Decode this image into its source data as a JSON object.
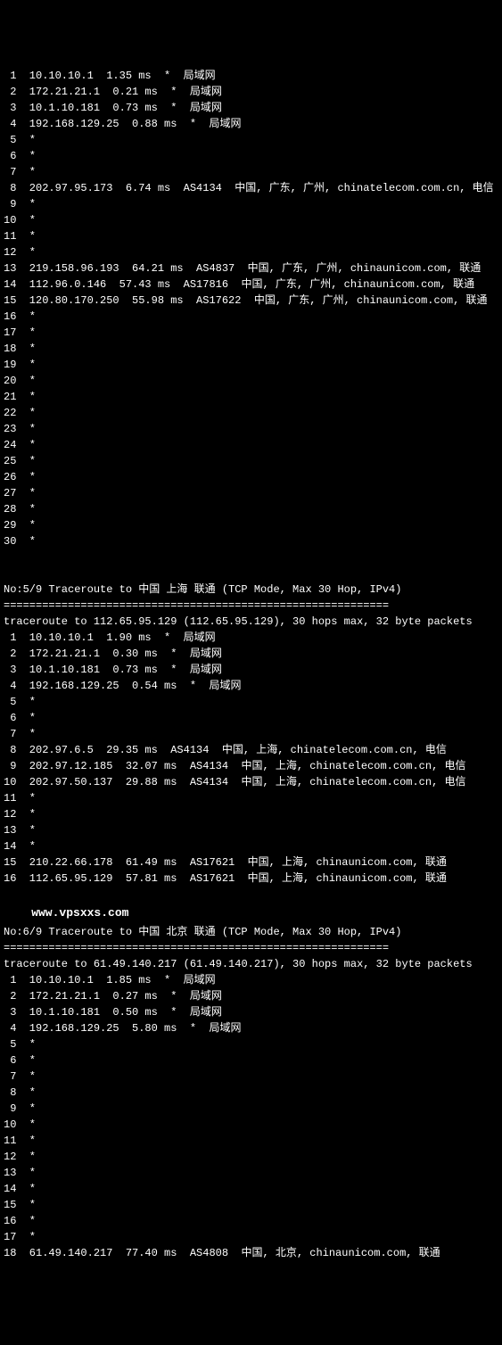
{
  "section1": {
    "hops": [
      {
        "n": " 1",
        "ip": "10.10.10.1",
        "lat": "1.35 ms",
        "star": "*",
        "info": "局域网"
      },
      {
        "n": " 2",
        "ip": "172.21.21.1",
        "lat": "0.21 ms",
        "star": "*",
        "info": "局域网"
      },
      {
        "n": " 3",
        "ip": "10.1.10.181",
        "lat": "0.73 ms",
        "star": "*",
        "info": "局域网"
      },
      {
        "n": " 4",
        "ip": "192.168.129.25",
        "lat": "0.88 ms",
        "star": "*",
        "info": "局域网"
      },
      {
        "n": " 5",
        "ip": "*",
        "lat": "",
        "star": "",
        "info": ""
      },
      {
        "n": " 6",
        "ip": "*",
        "lat": "",
        "star": "",
        "info": ""
      },
      {
        "n": " 7",
        "ip": "*",
        "lat": "",
        "star": "",
        "info": ""
      },
      {
        "n": " 8",
        "ip": "202.97.95.173",
        "lat": "6.74 ms",
        "star": "",
        "info": "AS4134  中国, 广东, 广州, chinatelecom.com.cn, 电信"
      },
      {
        "n": " 9",
        "ip": "*",
        "lat": "",
        "star": "",
        "info": ""
      },
      {
        "n": "10",
        "ip": "*",
        "lat": "",
        "star": "",
        "info": ""
      },
      {
        "n": "11",
        "ip": "*",
        "lat": "",
        "star": "",
        "info": ""
      },
      {
        "n": "12",
        "ip": "*",
        "lat": "",
        "star": "",
        "info": ""
      },
      {
        "n": "13",
        "ip": "219.158.96.193",
        "lat": "64.21 ms",
        "star": "",
        "info": "AS4837  中国, 广东, 广州, chinaunicom.com, 联通"
      },
      {
        "n": "14",
        "ip": "112.96.0.146",
        "lat": "57.43 ms",
        "star": "",
        "info": "AS17816  中国, 广东, 广州, chinaunicom.com, 联通"
      },
      {
        "n": "15",
        "ip": "120.80.170.250",
        "lat": "55.98 ms",
        "star": "",
        "info": "AS17622  中国, 广东, 广州, chinaunicom.com, 联通"
      },
      {
        "n": "16",
        "ip": "*",
        "lat": "",
        "star": "",
        "info": ""
      },
      {
        "n": "17",
        "ip": "*",
        "lat": "",
        "star": "",
        "info": ""
      },
      {
        "n": "18",
        "ip": "*",
        "lat": "",
        "star": "",
        "info": ""
      },
      {
        "n": "19",
        "ip": "*",
        "lat": "",
        "star": "",
        "info": ""
      },
      {
        "n": "20",
        "ip": "*",
        "lat": "",
        "star": "",
        "info": ""
      },
      {
        "n": "21",
        "ip": "*",
        "lat": "",
        "star": "",
        "info": ""
      },
      {
        "n": "22",
        "ip": "*",
        "lat": "",
        "star": "",
        "info": ""
      },
      {
        "n": "23",
        "ip": "*",
        "lat": "",
        "star": "",
        "info": ""
      },
      {
        "n": "24",
        "ip": "*",
        "lat": "",
        "star": "",
        "info": ""
      },
      {
        "n": "25",
        "ip": "*",
        "lat": "",
        "star": "",
        "info": ""
      },
      {
        "n": "26",
        "ip": "*",
        "lat": "",
        "star": "",
        "info": ""
      },
      {
        "n": "27",
        "ip": "*",
        "lat": "",
        "star": "",
        "info": ""
      },
      {
        "n": "28",
        "ip": "*",
        "lat": "",
        "star": "",
        "info": ""
      },
      {
        "n": "29",
        "ip": "*",
        "lat": "",
        "star": "",
        "info": ""
      },
      {
        "n": "30",
        "ip": "*",
        "lat": "",
        "star": "",
        "info": ""
      }
    ]
  },
  "section2": {
    "title": "No:5/9 Traceroute to 中国 上海 联通 (TCP Mode, Max 30 Hop, IPv4)",
    "divider": "============================================================",
    "header": "traceroute to 112.65.95.129 (112.65.95.129), 30 hops max, 32 byte packets",
    "hops": [
      {
        "n": " 1",
        "ip": "10.10.10.1",
        "lat": "1.90 ms",
        "star": "*",
        "info": "局域网"
      },
      {
        "n": " 2",
        "ip": "172.21.21.1",
        "lat": "0.30 ms",
        "star": "*",
        "info": "局域网"
      },
      {
        "n": " 3",
        "ip": "10.1.10.181",
        "lat": "0.73 ms",
        "star": "*",
        "info": "局域网"
      },
      {
        "n": " 4",
        "ip": "192.168.129.25",
        "lat": "0.54 ms",
        "star": "*",
        "info": "局域网"
      },
      {
        "n": " 5",
        "ip": "*",
        "lat": "",
        "star": "",
        "info": ""
      },
      {
        "n": " 6",
        "ip": "*",
        "lat": "",
        "star": "",
        "info": ""
      },
      {
        "n": " 7",
        "ip": "*",
        "lat": "",
        "star": "",
        "info": ""
      },
      {
        "n": " 8",
        "ip": "202.97.6.5",
        "lat": "29.35 ms",
        "star": "",
        "info": "AS4134  中国, 上海, chinatelecom.com.cn, 电信"
      },
      {
        "n": " 9",
        "ip": "202.97.12.185",
        "lat": "32.07 ms",
        "star": "",
        "info": "AS4134  中国, 上海, chinatelecom.com.cn, 电信"
      },
      {
        "n": "10",
        "ip": "202.97.50.137",
        "lat": "29.88 ms",
        "star": "",
        "info": "AS4134  中国, 上海, chinatelecom.com.cn, 电信"
      },
      {
        "n": "11",
        "ip": "*",
        "lat": "",
        "star": "",
        "info": ""
      },
      {
        "n": "12",
        "ip": "*",
        "lat": "",
        "star": "",
        "info": ""
      },
      {
        "n": "13",
        "ip": "*",
        "lat": "",
        "star": "",
        "info": ""
      },
      {
        "n": "14",
        "ip": "*",
        "lat": "",
        "star": "",
        "info": ""
      },
      {
        "n": "15",
        "ip": "210.22.66.178",
        "lat": "61.49 ms",
        "star": "",
        "info": "AS17621  中国, 上海, chinaunicom.com, 联通"
      },
      {
        "n": "16",
        "ip": "112.65.95.129",
        "lat": "57.81 ms",
        "star": "",
        "info": "AS17621  中国, 上海, chinaunicom.com, 联通"
      }
    ]
  },
  "watermark": "www.vpsxxs.com",
  "section3": {
    "title": "No:6/9 Traceroute to 中国 北京 联通 (TCP Mode, Max 30 Hop, IPv4)",
    "divider": "============================================================",
    "header": "traceroute to 61.49.140.217 (61.49.140.217), 30 hops max, 32 byte packets",
    "hops": [
      {
        "n": " 1",
        "ip": "10.10.10.1",
        "lat": "1.85 ms",
        "star": "*",
        "info": "局域网"
      },
      {
        "n": " 2",
        "ip": "172.21.21.1",
        "lat": "0.27 ms",
        "star": "*",
        "info": "局域网"
      },
      {
        "n": " 3",
        "ip": "10.1.10.181",
        "lat": "0.50 ms",
        "star": "*",
        "info": "局域网"
      },
      {
        "n": " 4",
        "ip": "192.168.129.25",
        "lat": "5.80 ms",
        "star": "*",
        "info": "局域网"
      },
      {
        "n": " 5",
        "ip": "*",
        "lat": "",
        "star": "",
        "info": ""
      },
      {
        "n": " 6",
        "ip": "*",
        "lat": "",
        "star": "",
        "info": ""
      },
      {
        "n": " 7",
        "ip": "*",
        "lat": "",
        "star": "",
        "info": ""
      },
      {
        "n": " 8",
        "ip": "*",
        "lat": "",
        "star": "",
        "info": ""
      },
      {
        "n": " 9",
        "ip": "*",
        "lat": "",
        "star": "",
        "info": ""
      },
      {
        "n": "10",
        "ip": "*",
        "lat": "",
        "star": "",
        "info": ""
      },
      {
        "n": "11",
        "ip": "*",
        "lat": "",
        "star": "",
        "info": ""
      },
      {
        "n": "12",
        "ip": "*",
        "lat": "",
        "star": "",
        "info": ""
      },
      {
        "n": "13",
        "ip": "*",
        "lat": "",
        "star": "",
        "info": ""
      },
      {
        "n": "14",
        "ip": "*",
        "lat": "",
        "star": "",
        "info": ""
      },
      {
        "n": "15",
        "ip": "*",
        "lat": "",
        "star": "",
        "info": ""
      },
      {
        "n": "16",
        "ip": "*",
        "lat": "",
        "star": "",
        "info": ""
      },
      {
        "n": "17",
        "ip": "*",
        "lat": "",
        "star": "",
        "info": ""
      },
      {
        "n": "18",
        "ip": "61.49.140.217",
        "lat": "77.40 ms",
        "star": "",
        "info": "AS4808  中国, 北京, chinaunicom.com, 联通"
      }
    ]
  }
}
